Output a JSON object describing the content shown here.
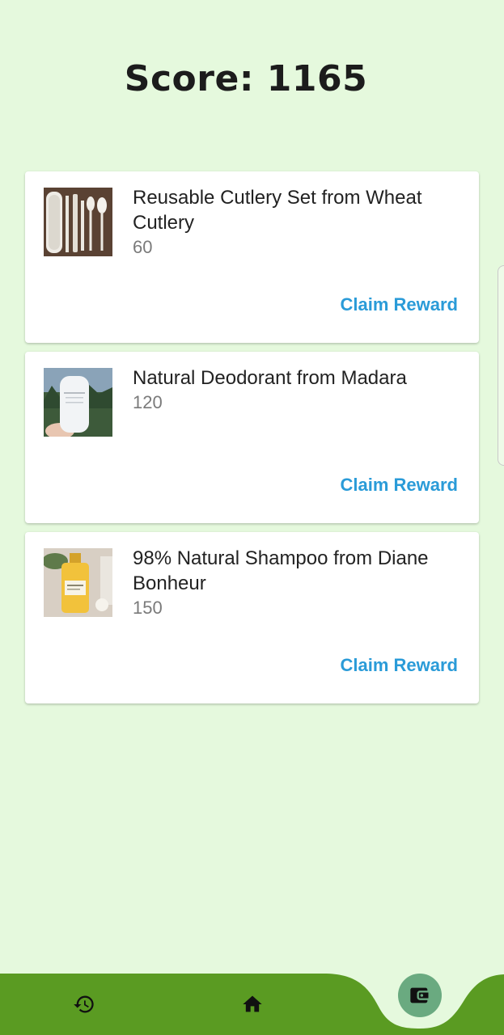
{
  "score_text": "Score: 1165",
  "rewards": [
    {
      "title": "Reusable Cutlery Set from Wheat Cutlery",
      "cost": "60",
      "action": "Claim Reward",
      "image": "cutlery-set-photo"
    },
    {
      "title": "Natural Deodorant from Madara",
      "cost": "120",
      "action": "Claim Reward",
      "image": "deodorant-photo"
    },
    {
      "title": "98% Natural Shampoo from Diane Bonheur",
      "cost": "150",
      "action": "Claim Reward",
      "image": "shampoo-photo"
    }
  ],
  "bottom_nav": {
    "items": [
      {
        "icon": "history-icon"
      },
      {
        "icon": "home-icon"
      },
      {
        "icon": "wallet-icon",
        "active": true
      }
    ]
  },
  "colors": {
    "background": "#e5f9dd",
    "nav_green": "#5a9b22",
    "accent_link": "#2a9bd8",
    "active_tab": "#6aaa80"
  }
}
